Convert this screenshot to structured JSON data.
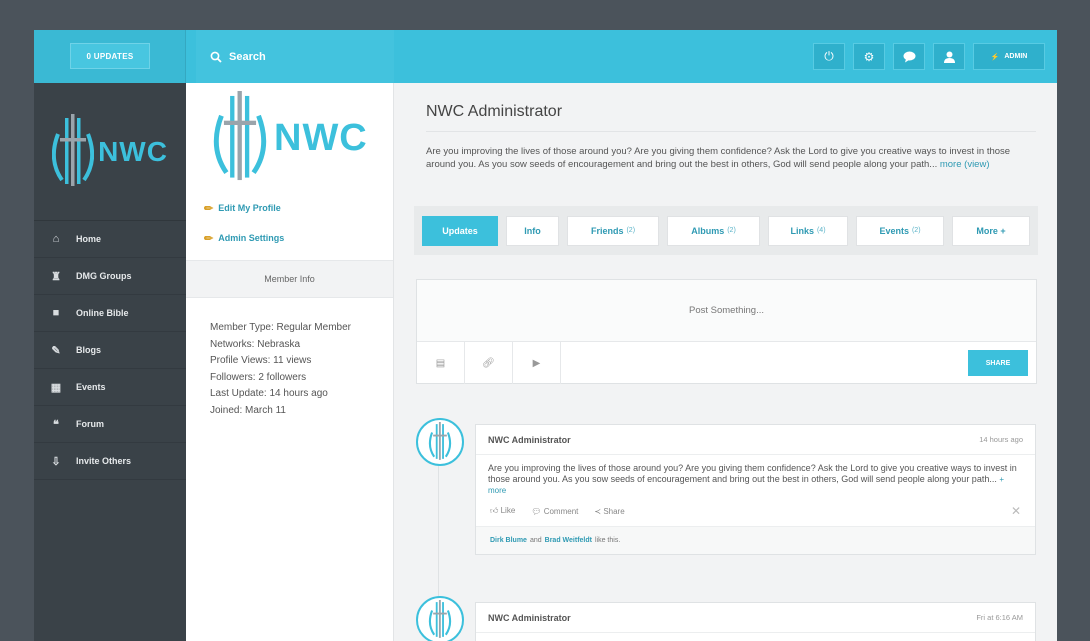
{
  "topbar": {
    "updates_label": "0 UPDATES",
    "search_placeholder": "Search",
    "admin_label": "ADMIN"
  },
  "sidebar": {
    "logo_text": "NWC",
    "items": [
      {
        "label": "Home",
        "icon": "home-icon"
      },
      {
        "label": "DMG Groups",
        "icon": "groups-icon"
      },
      {
        "label": "Online Bible",
        "icon": "book-icon"
      },
      {
        "label": "Blogs",
        "icon": "blog-icon"
      },
      {
        "label": "Events",
        "icon": "calendar-icon"
      },
      {
        "label": "Forum",
        "icon": "forum-icon"
      },
      {
        "label": "Invite Others",
        "icon": "invite-icon"
      }
    ]
  },
  "profile": {
    "logo_text": "NWC",
    "edit_profile": "Edit My Profile",
    "admin_settings": "Admin Settings",
    "member_info_title": "Member Info",
    "info": [
      "Member Type: Regular Member",
      "Networks: Nebraska",
      "Profile Views: 11 views",
      "Followers: 2 followers",
      "Last Update: 14 hours ago",
      "Joined: March 11"
    ]
  },
  "main": {
    "title": "NWC Administrator",
    "description": "Are you improving the lives of those around you? Are you giving them confidence? Ask the Lord to give you creative ways to invest in those around you. As you sow seeds of encouragement and bring out the best in others, God will send people along your path...",
    "more_label": "more",
    "view_label": "(view)",
    "tabs": [
      {
        "label": "Updates",
        "count": ""
      },
      {
        "label": "Info",
        "count": ""
      },
      {
        "label": "Friends",
        "count": "(2)"
      },
      {
        "label": "Albums",
        "count": "(2)"
      },
      {
        "label": "Links",
        "count": "(4)"
      },
      {
        "label": "Events",
        "count": "(2)"
      },
      {
        "label": "More +",
        "count": ""
      }
    ],
    "post_placeholder": "Post Something...",
    "share_label": "SHARE"
  },
  "feed": [
    {
      "name": "NWC Administrator",
      "time": "14 hours ago",
      "body": "Are you improving the lives of those around you? Are you giving them confidence? Ask the Lord to give you creative ways to invest in those around you. As you sow seeds of encouragement and bring out the best in others, God will send people along your path...",
      "more": "+ more",
      "like": "Like",
      "comment": "Comment",
      "share": "Share",
      "liker1": "Dirk Blume",
      "and": "and",
      "liker2": "Brad Weitfeldt",
      "likes_suffix": "like this."
    },
    {
      "name": "NWC Administrator",
      "time": "Fri at 6:16 AM"
    }
  ],
  "colors": {
    "accent": "#3cc0dc",
    "sidebar": "#3a4248",
    "background": "#4b535b"
  }
}
